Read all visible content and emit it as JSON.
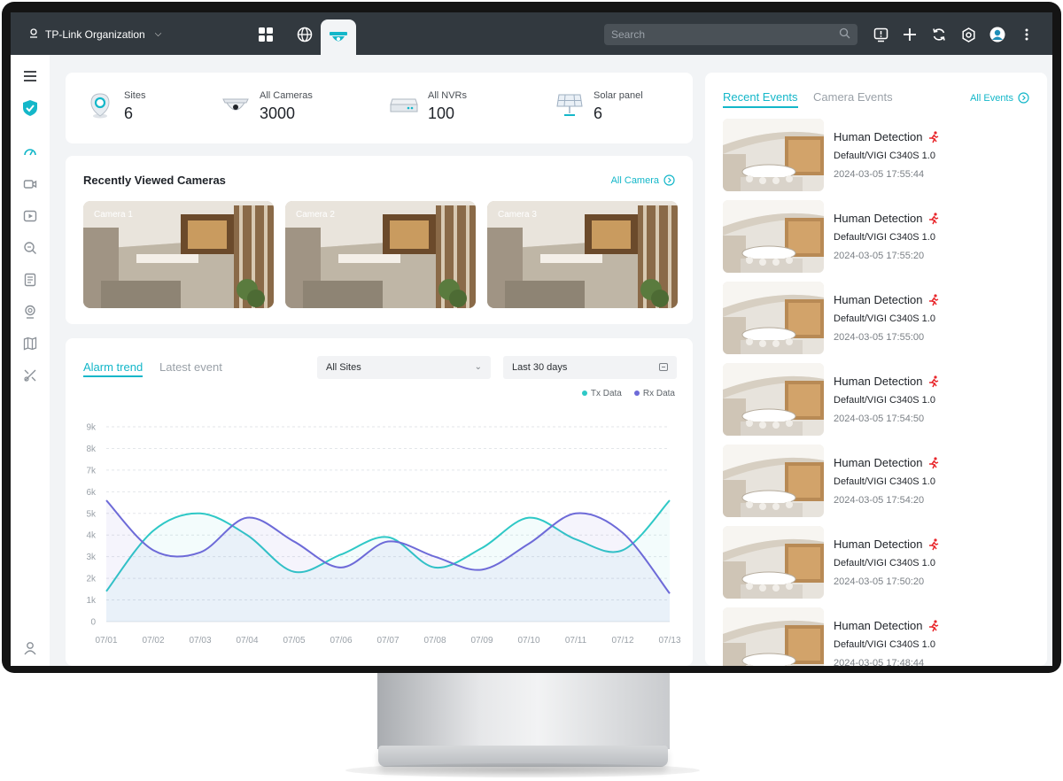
{
  "topbar": {
    "org_name": "TP-Link Organization",
    "search_placeholder": "Search"
  },
  "stats": [
    {
      "label": "Sites",
      "value": "6"
    },
    {
      "label": "All Cameras",
      "value": "3000"
    },
    {
      "label": "All NVRs",
      "value": "100"
    },
    {
      "label": "Solar panel",
      "value": "6"
    }
  ],
  "recent_cameras": {
    "title": "Recently Viewed Cameras",
    "link": "All Camera",
    "cameras": [
      "Camera 1",
      "Camera 2",
      "Camera 3"
    ]
  },
  "trend": {
    "tabs": [
      "Alarm trend",
      "Latest event"
    ],
    "site_select": "All Sites",
    "range_select": "Last 30 days"
  },
  "chart_data": {
    "type": "line",
    "x": [
      "07/01",
      "07/02",
      "07/03",
      "07/04",
      "07/05",
      "07/06",
      "07/07",
      "07/08",
      "07/09",
      "07/10",
      "07/11",
      "07/12",
      "07/13"
    ],
    "yticks": [
      "0",
      "1k",
      "2k",
      "3k",
      "4k",
      "5k",
      "6k",
      "7k",
      "8k",
      "9k"
    ],
    "ylim": [
      0,
      9000
    ],
    "series": [
      {
        "name": "Tx Data",
        "color": "#2ec8c6",
        "values": [
          1400,
          4200,
          5000,
          4000,
          2300,
          3100,
          3900,
          2500,
          3400,
          4800,
          3800,
          3300,
          5600
        ]
      },
      {
        "name": "Rx Data",
        "color": "#6d6ad8",
        "values": [
          5600,
          3300,
          3200,
          4800,
          3700,
          2500,
          3700,
          3000,
          2400,
          3600,
          5000,
          4100,
          1300
        ]
      }
    ],
    "grid": true,
    "legend": "top-right"
  },
  "events": {
    "tabs": [
      "Recent Events",
      "Camera Events"
    ],
    "all_link": "All Events",
    "items": [
      {
        "title": "Human Detection",
        "device": "Default/VIGI C340S 1.0",
        "time": "2024-03-05 17:55:44"
      },
      {
        "title": "Human Detection",
        "device": "Default/VIGI C340S 1.0",
        "time": "2024-03-05 17:55:20"
      },
      {
        "title": "Human Detection",
        "device": "Default/VIGI C340S 1.0",
        "time": "2024-03-05 17:55:00"
      },
      {
        "title": "Human Detection",
        "device": "Default/VIGI C340S 1.0",
        "time": "2024-03-05 17:54:50"
      },
      {
        "title": "Human Detection",
        "device": "Default/VIGI C340S 1.0",
        "time": "2024-03-05 17:54:20"
      },
      {
        "title": "Human Detection",
        "device": "Default/VIGI C340S 1.0",
        "time": "2024-03-05 17:50:20"
      },
      {
        "title": "Human Detection",
        "device": "Default/VIGI C340S 1.0",
        "time": "2024-03-05 17:48:44"
      }
    ]
  }
}
